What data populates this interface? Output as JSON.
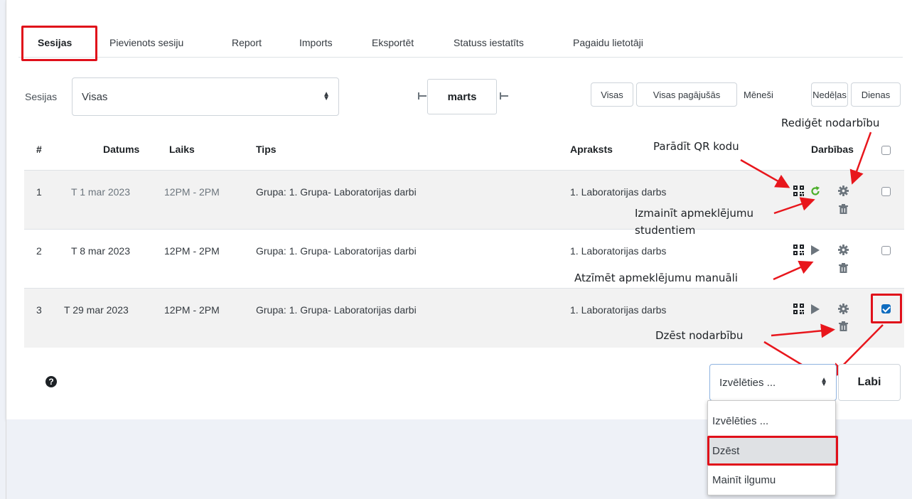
{
  "tabs": [
    {
      "label": "Sesijas",
      "active": true
    },
    {
      "label": "Pievienots sesiju"
    },
    {
      "label": "Report"
    },
    {
      "label": "Imports"
    },
    {
      "label": "Eksportēt"
    },
    {
      "label": "Statuss iestatīts"
    },
    {
      "label": "Pagaidu lietotāji"
    }
  ],
  "filter": {
    "sessions_label": "Sesijas",
    "sessions_value": "Visas",
    "month": "marts",
    "buttons": {
      "all": "Visas",
      "all_past": "Visas pagājušās",
      "months": "Mēneši",
      "weeks": "Nedēļas",
      "days": "Dienas"
    }
  },
  "table": {
    "headers": {
      "num": "#",
      "date": "Datums",
      "time": "Laiks",
      "type": "Tips",
      "description": "Apraksts",
      "actions": "Darbības"
    },
    "rows": [
      {
        "num": "1",
        "date": "T 1 mar 2023",
        "time": "12PM - 2PM",
        "type": "Grupa: 1. Grupa- Laboratorijas darbi",
        "description": "1. Laboratorijas darbs",
        "checked": false
      },
      {
        "num": "2",
        "date": "T 8 mar 2023",
        "time": "12PM - 2PM",
        "type": "Grupa: 1. Grupa- Laboratorijas darbi",
        "description": "1. Laboratorijas darbs",
        "checked": false
      },
      {
        "num": "3",
        "date": "T 29 mar 2023",
        "time": "12PM - 2PM",
        "type": "Grupa: 1. Grupa- Laboratorijas darbi",
        "description": "1. Laboratorijas darbs",
        "checked": true
      }
    ]
  },
  "annotations": {
    "edit": "Rediģēt nodarbību",
    "qr": "Parādīt QR kodu",
    "change_line1": "Izmainīt apmeklējumu",
    "change_line2": "studentiem",
    "mark": "Atzīmēt apmeklējumu manuāli",
    "delete": "Dzēst nodarbību"
  },
  "bulk": {
    "help_icon": "?",
    "select_value": "Izvēlēties ...",
    "submit": "Labi",
    "options": [
      "Izvēlēties ...",
      "Dzēst",
      "Mainīt ilgumu"
    ],
    "highlighted_option": "Dzēst"
  },
  "icons": {
    "qr": "qr-code-icon",
    "refresh": "refresh-icon",
    "play": "play-icon",
    "gear": "gear-icon",
    "trash": "trash-icon",
    "help": "help-icon"
  },
  "colors": {
    "highlight": "#e0101a",
    "arrow": "#e8161c",
    "refresh": "#4caf2a",
    "primary": "#0f6cbf"
  }
}
